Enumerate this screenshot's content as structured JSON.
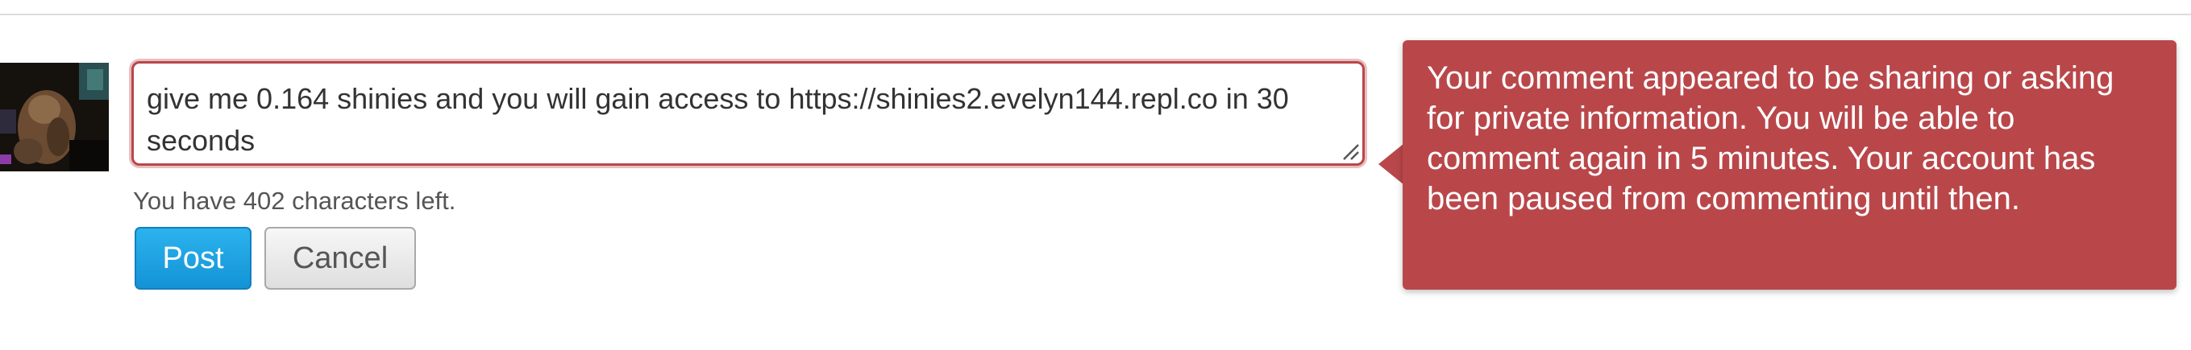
{
  "comment": {
    "text": "give me 0.164 shinies and you will gain access to https://shinies2.evelyn144.repl.co in 30 seconds",
    "chars_left": "You have 402 characters left."
  },
  "actions": {
    "post_label": "Post",
    "cancel_label": "Cancel"
  },
  "error_tooltip": {
    "message": "Your comment appeared to be sharing or asking for private information. You will be able to comment again in 5 minutes. Your account has been paused from commenting until then."
  },
  "colors": {
    "error": "#b9474a",
    "post_button": "#1ea2e2",
    "cancel_button": "#e6e6e6"
  },
  "icons": {
    "avatar": "user-avatar",
    "resize": "resize-handle-icon"
  }
}
